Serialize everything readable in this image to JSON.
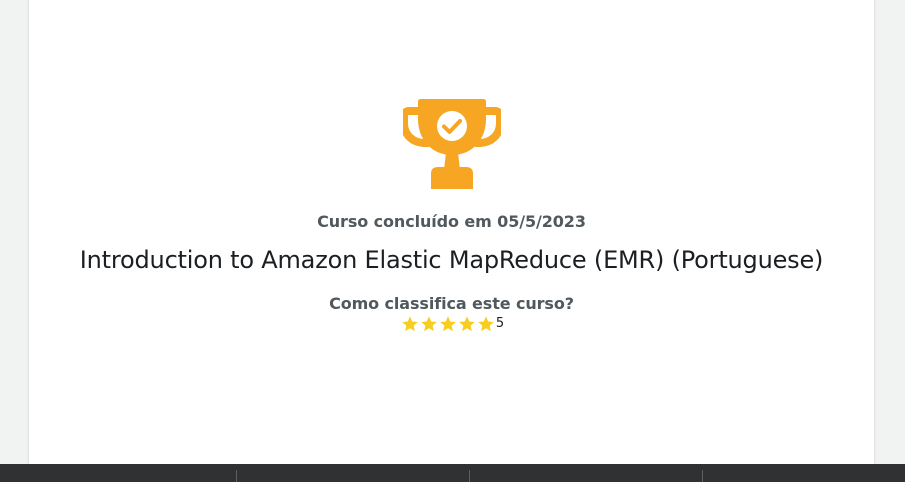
{
  "completion": {
    "text": "Curso concluído em 05/5/2023",
    "trophy_icon": "trophy-check-icon",
    "trophy_color": "#f6a623"
  },
  "course": {
    "title": "Introduction to Amazon Elastic MapReduce (EMR) (Portuguese)"
  },
  "rating": {
    "question": "Como classifica este curso?",
    "value": "5",
    "max_stars": 5,
    "filled_stars": 5,
    "star_icon": "star-icon",
    "star_color": "#f7ce1e"
  },
  "colors": {
    "page_background": "#f1f2f2",
    "card_background": "#ffffff",
    "footer_background": "#2f3133"
  }
}
